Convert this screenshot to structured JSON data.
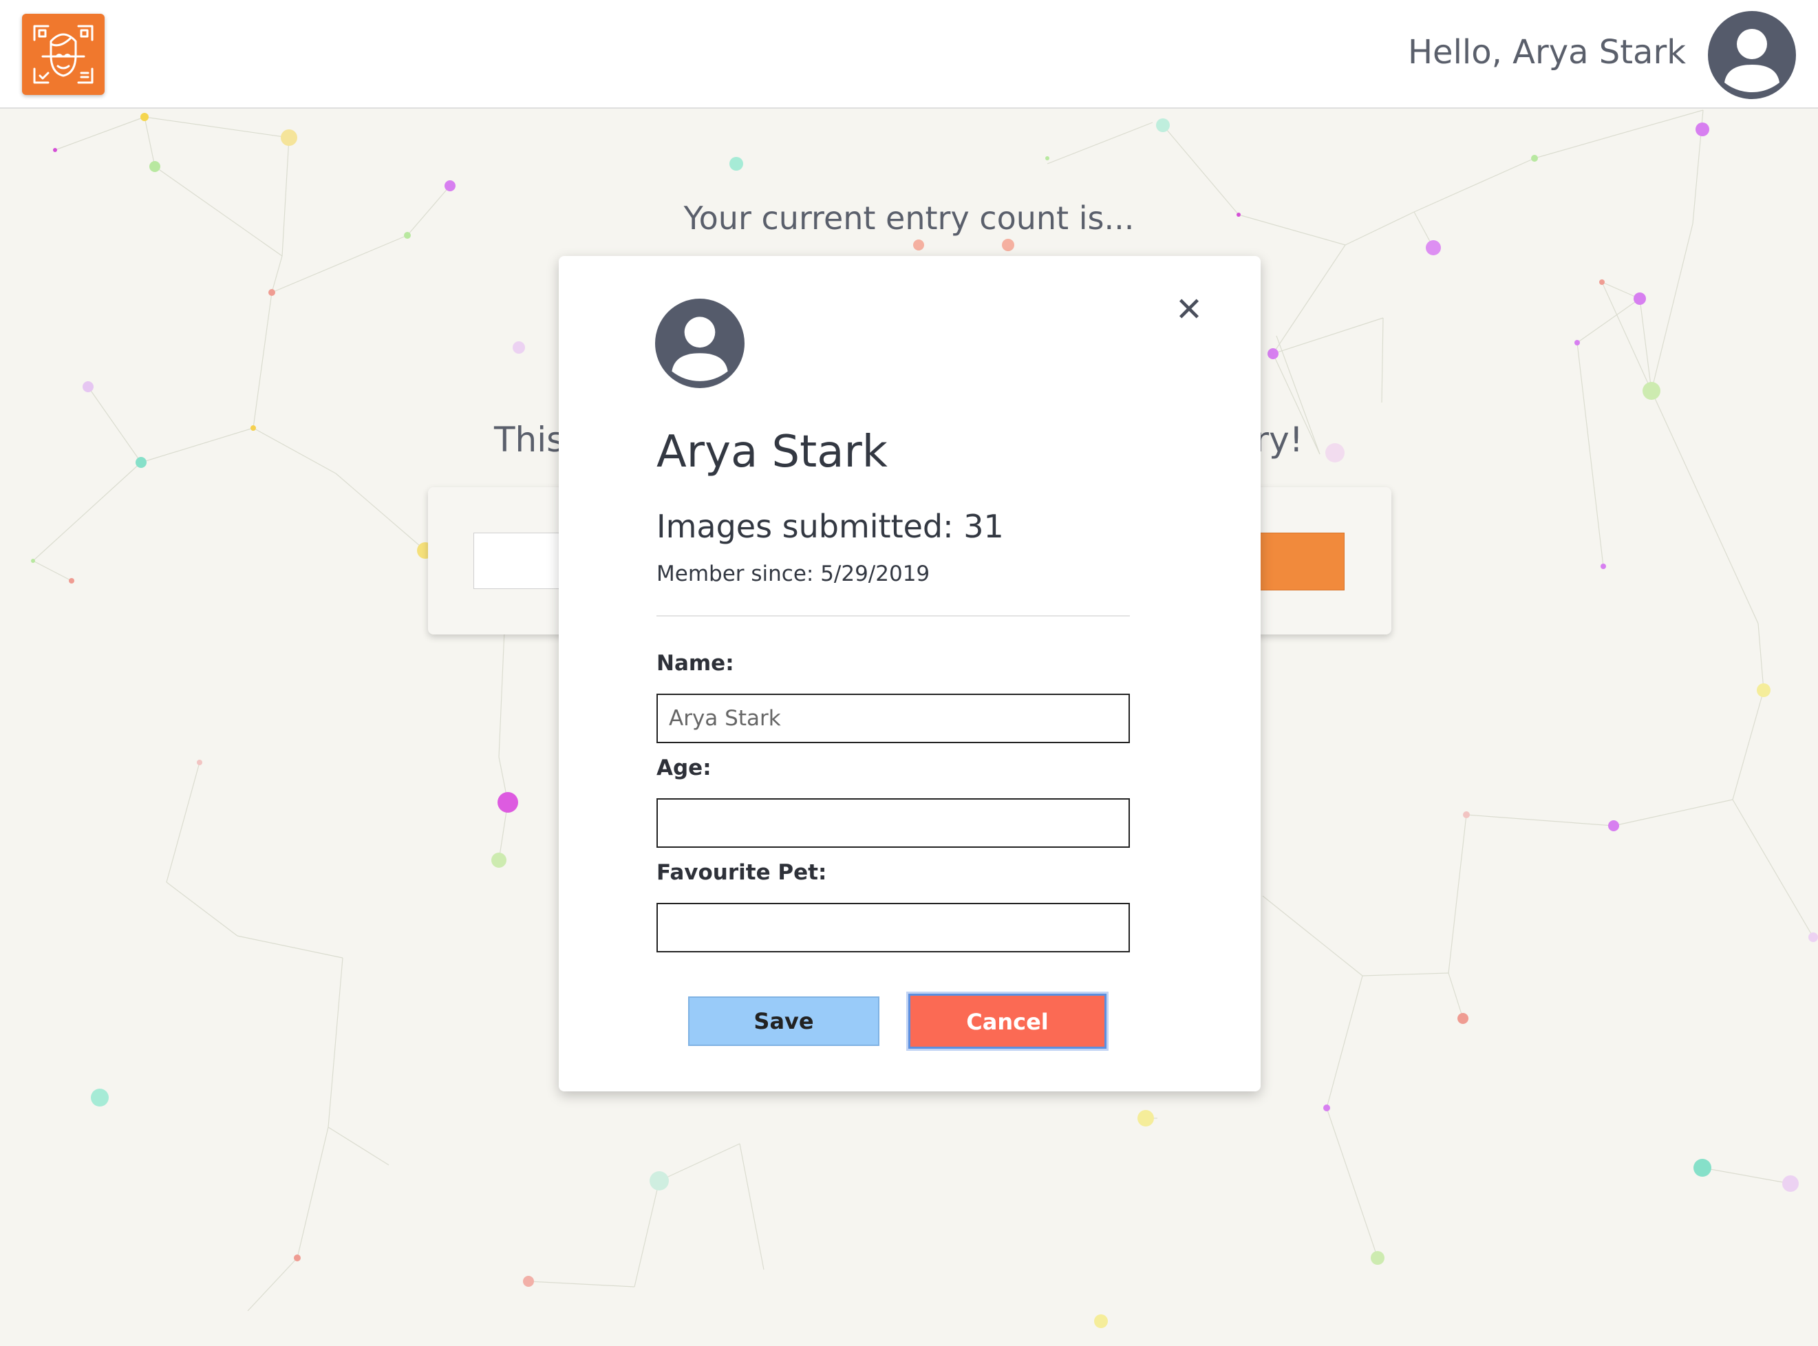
{
  "header": {
    "greeting": "Hello, Arya Stark",
    "logo_icon": "face-scan-icon",
    "avatar_icon": "user-avatar-icon"
  },
  "page": {
    "entry_heading": "Your current entry count is...",
    "tagline_left": "This",
    "tagline_right": "try!"
  },
  "modal": {
    "avatar_icon": "user-avatar-icon",
    "close_symbol": "✕",
    "name": "Arya Stark",
    "images_submitted": "Images submitted: 31",
    "member_since": "Member since: 5/29/2019",
    "fields": {
      "name_label": "Name:",
      "name_value": "Arya Stark",
      "age_label": "Age:",
      "age_value": "",
      "pet_label": "Favourite Pet:",
      "pet_value": ""
    },
    "save_label": "Save",
    "cancel_label": "Cancel"
  },
  "colors": {
    "brand_orange": "#f0782d",
    "save_blue": "#99cbf9",
    "cancel_red": "#fb6a54",
    "avatar_gray": "#555b6b"
  }
}
